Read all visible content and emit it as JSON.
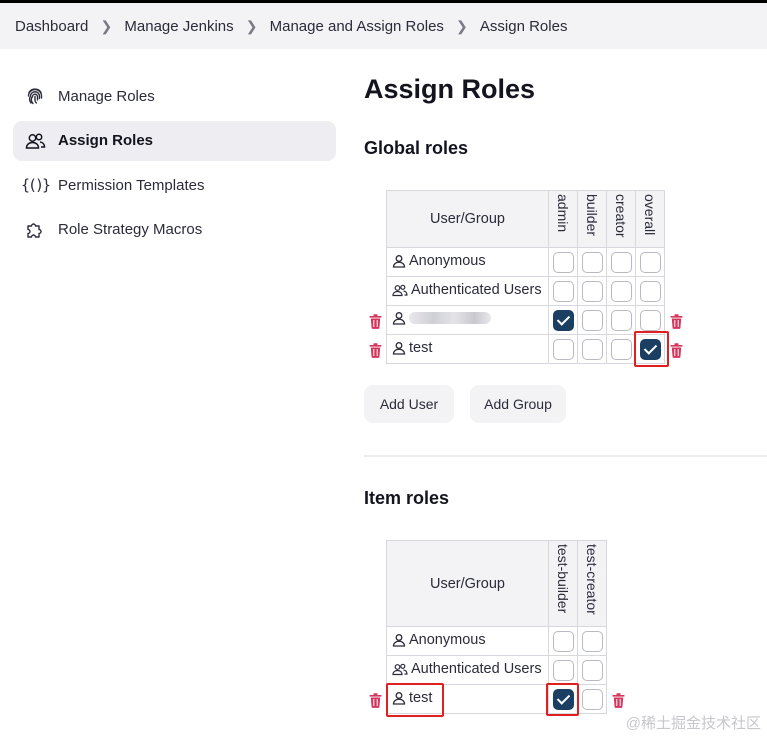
{
  "breadcrumb": [
    "Dashboard",
    "Manage Jenkins",
    "Manage and Assign Roles",
    "Assign Roles"
  ],
  "sidebar": {
    "items": [
      {
        "label": "Manage Roles",
        "icon": "fingerprint-icon",
        "active": false
      },
      {
        "label": "Assign Roles",
        "icon": "users-icon",
        "active": true
      },
      {
        "label": "Permission Templates",
        "icon": "braces-icon",
        "active": false
      },
      {
        "label": "Role Strategy Macros",
        "icon": "puzzle-icon",
        "active": false
      }
    ]
  },
  "page": {
    "title": "Assign Roles"
  },
  "global_roles": {
    "title": "Global roles",
    "header": "User/Group",
    "columns": [
      "admin",
      "builder",
      "creator",
      "overall"
    ],
    "rows": [
      {
        "name": "Anonymous",
        "type": "user",
        "checks": [
          false,
          false,
          false,
          false
        ],
        "deletable": false
      },
      {
        "name": "Authenticated Users",
        "type": "group",
        "checks": [
          false,
          false,
          false,
          false
        ],
        "deletable": false
      },
      {
        "name": "",
        "type": "user",
        "redacted": true,
        "checks": [
          true,
          false,
          false,
          false
        ],
        "deletable": true
      },
      {
        "name": "test",
        "type": "user",
        "checks": [
          false,
          false,
          false,
          true
        ],
        "deletable": true
      }
    ],
    "add_user": "Add User",
    "add_group": "Add Group"
  },
  "item_roles": {
    "title": "Item roles",
    "header": "User/Group",
    "columns": [
      "test-builder",
      "test-creator"
    ],
    "rows": [
      {
        "name": "Anonymous",
        "type": "user",
        "checks": [
          false,
          false
        ],
        "deletable": false
      },
      {
        "name": "Authenticated Users",
        "type": "group",
        "checks": [
          false,
          false
        ],
        "deletable": false
      },
      {
        "name": "test",
        "type": "user",
        "checks": [
          true,
          false
        ],
        "deletable": true
      }
    ]
  },
  "colors": {
    "checked": "#1a3f63",
    "trash": "#d4365c",
    "highlight": "#e02020"
  },
  "watermark": "@稀土掘金技术社区"
}
